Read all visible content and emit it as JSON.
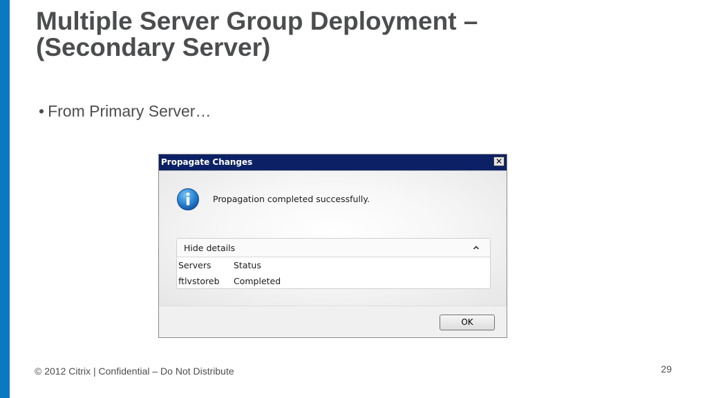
{
  "slide": {
    "title_line1": "Multiple Server Group Deployment –",
    "title_line2": "(Secondary Server)",
    "bullet_marker": "•",
    "bullet": "From Primary Server…",
    "footer": "© 2012 Citrix | Confidential – Do Not Distribute",
    "page_number": "29",
    "accent_color": "#0a78c2"
  },
  "dialog": {
    "title": "Propagate Changes",
    "close_label": "✕",
    "icon": "info-icon",
    "message": "Propagation completed successfully.",
    "details": {
      "toggle_label": "Hide details",
      "toggle_icon": "chevron-up-icon",
      "columns": [
        "Servers",
        "Status"
      ],
      "rows": [
        [
          "ftlvstoreb",
          "Completed"
        ]
      ]
    },
    "ok_label": "OK",
    "titlebar_color": "#0c2165"
  }
}
